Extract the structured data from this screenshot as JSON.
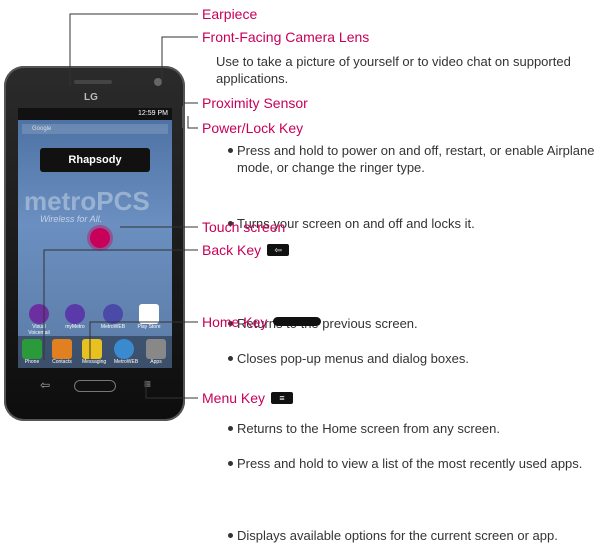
{
  "callouts": {
    "earpiece": "Earpiece",
    "front_camera": "Front-Facing Camera Lens",
    "front_camera_desc": "Use to take a picture of yourself or to video chat on supported applications.",
    "proximity": "Proximity Sensor",
    "power_lock": "Power/Lock Key",
    "power_lock_bullets": [
      "Press and hold to power on and off, restart, or enable Airplane mode, or change the ringer type.",
      "Turns your screen on and off and locks it."
    ],
    "touch_screen": "Touch screen",
    "back_key": "Back Key",
    "back_key_bullets": [
      "Returns to the previous screen.",
      "Closes pop-up menus and dialog boxes."
    ],
    "home_key": "Home Key",
    "home_key_bullets": [
      "Returns to the Home screen from any screen.",
      "Press and hold to view a list of the most recently used apps."
    ],
    "menu_key": "Menu Key",
    "menu_key_bullets": [
      "Displays available options for the current screen or app."
    ]
  },
  "phone": {
    "brand": "LG",
    "status_time": "12:59 PM",
    "search_text": "Google",
    "rhapsody": "Rhapsody",
    "watermark": "metroPCS",
    "watermark_sub": "Wireless for All.",
    "apps_row": [
      "Visual Voicemail",
      "myMetro",
      "MetroWEB",
      "Play Store"
    ],
    "dock": [
      "Phone",
      "Contacts",
      "Messaging",
      "MetroWEB",
      "Apps"
    ]
  },
  "colors": {
    "accent": "#c8005a"
  }
}
